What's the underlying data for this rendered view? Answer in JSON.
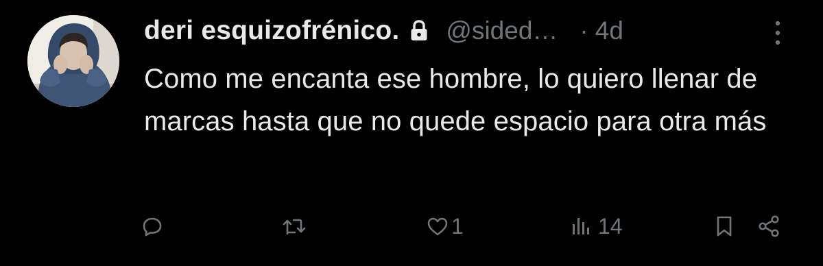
{
  "tweet": {
    "display_name": "deri esquizofrénico.",
    "handle": "@sided…",
    "separator": "·",
    "time": "4d",
    "text": "Como me encanta ese hombre, lo quiero llenar de marcas hasta que no quede espacio para otra más",
    "icons": {
      "lock": "lock-icon",
      "more": "more-vertical-icon"
    }
  },
  "actions": {
    "reply": {
      "icon": "reply-icon",
      "count": ""
    },
    "retweet": {
      "icon": "retweet-icon",
      "count": ""
    },
    "like": {
      "icon": "heart-icon",
      "count": "1"
    },
    "views": {
      "icon": "views-icon",
      "count": "14"
    },
    "bookmark": {
      "icon": "bookmark-icon",
      "count": ""
    },
    "share": {
      "icon": "share-icon",
      "count": ""
    }
  },
  "colors": {
    "background": "#000000",
    "primary_text": "#e7e9ea",
    "secondary_text": "#71767b"
  }
}
